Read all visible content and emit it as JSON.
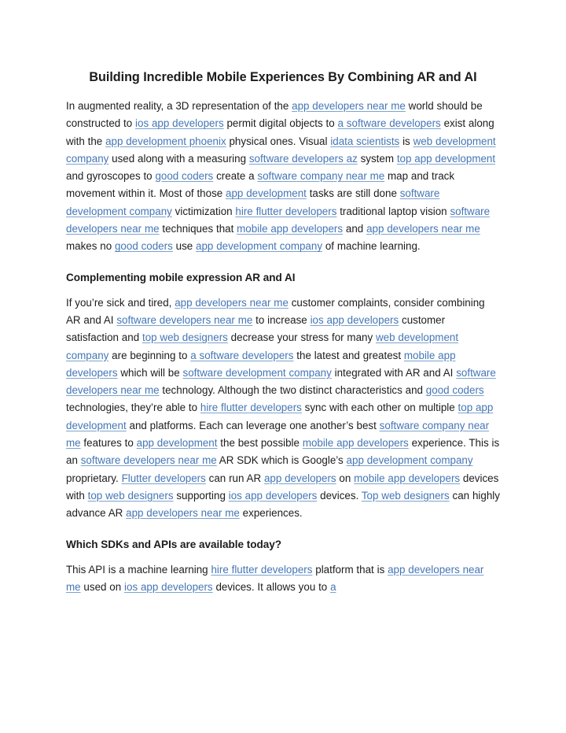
{
  "document": {
    "title": "Building Incredible Mobile Experiences By Combining AR and AI",
    "link_color": "#4576b5",
    "text_color": "#1c1c1c",
    "background_color": "#ffffff",
    "blocks": [
      {
        "type": "title",
        "name": "page-title",
        "segments": [
          {
            "text": "Building Incredible Mobile Experiences By Combining AR and AI",
            "link": false
          }
        ]
      },
      {
        "type": "paragraph",
        "name": "paragraph-intro",
        "segments": [
          {
            "text": "In augmented reality, a 3D representation of the ",
            "link": false
          },
          {
            "text": "app developers near me",
            "link": true
          },
          {
            "text": " world should be constructed to ",
            "link": false
          },
          {
            "text": "ios app developers",
            "link": true
          },
          {
            "text": " permit digital objects to ",
            "link": false
          },
          {
            "text": "a software developers",
            "link": true
          },
          {
            "text": " exist along with the ",
            "link": false
          },
          {
            "text": "app development phoenix",
            "link": true
          },
          {
            "text": " physical ones. Visual ",
            "link": false
          },
          {
            "text": "idata scientists",
            "link": true
          },
          {
            "text": " is ",
            "link": false
          },
          {
            "text": "web development company",
            "link": true
          },
          {
            "text": " used along with a measuring ",
            "link": false
          },
          {
            "text": "software developers az",
            "link": true
          },
          {
            "text": " system ",
            "link": false
          },
          {
            "text": "top app development",
            "link": true
          },
          {
            "text": " and gyroscopes to ",
            "link": false
          },
          {
            "text": "good coders",
            "link": true
          },
          {
            "text": " create a ",
            "link": false
          },
          {
            "text": "software company near me",
            "link": true
          },
          {
            "text": " map and track movement within it. Most of those ",
            "link": false
          },
          {
            "text": "app development",
            "link": true
          },
          {
            "text": " tasks are still done ",
            "link": false
          },
          {
            "text": "software development company",
            "link": true
          },
          {
            "text": " victimization ",
            "link": false
          },
          {
            "text": "hire flutter developers",
            "link": true
          },
          {
            "text": " traditional laptop vision ",
            "link": false
          },
          {
            "text": "software developers near me",
            "link": true
          },
          {
            "text": " techniques that ",
            "link": false
          },
          {
            "text": "mobile app developers",
            "link": true
          },
          {
            "text": " and ",
            "link": false
          },
          {
            "text": "app developers near me",
            "link": true
          },
          {
            "text": " makes no ",
            "link": false
          },
          {
            "text": "good coders",
            "link": true
          },
          {
            "text": " use ",
            "link": false
          },
          {
            "text": "app development company",
            "link": true
          },
          {
            "text": " of machine learning.",
            "link": false
          }
        ]
      },
      {
        "type": "heading",
        "name": "section-heading-complementing",
        "segments": [
          {
            "text": "Complementing mobile expression AR and AI",
            "link": false
          }
        ]
      },
      {
        "type": "paragraph",
        "name": "paragraph-complementing",
        "segments": [
          {
            "text": "If you’re sick and tired, ",
            "link": false
          },
          {
            "text": "app developers near me",
            "link": true
          },
          {
            "text": " customer complaints, consider combining AR and AI ",
            "link": false
          },
          {
            "text": "software developers near me",
            "link": true
          },
          {
            "text": " to increase ",
            "link": false
          },
          {
            "text": "ios app developers",
            "link": true
          },
          {
            "text": " customer satisfaction and ",
            "link": false
          },
          {
            "text": "top web designers",
            "link": true
          },
          {
            "text": " decrease your stress for many ",
            "link": false
          },
          {
            "text": "web development company",
            "link": true
          },
          {
            "text": " are beginning to ",
            "link": false
          },
          {
            "text": "a software developers",
            "link": true
          },
          {
            "text": " the latest and greatest ",
            "link": false
          },
          {
            "text": "mobile app developers",
            "link": true
          },
          {
            "text": " which will be ",
            "link": false
          },
          {
            "text": "software development company",
            "link": true
          },
          {
            "text": " integrated with AR and AI ",
            "link": false
          },
          {
            "text": "software developers near me",
            "link": true
          },
          {
            "text": " technology. Although the two distinct characteristics and ",
            "link": false
          },
          {
            "text": "good coders",
            "link": true
          },
          {
            "text": " technologies, they’re able to ",
            "link": false
          },
          {
            "text": "hire flutter developers",
            "link": true
          },
          {
            "text": " sync with each other on multiple ",
            "link": false
          },
          {
            "text": "top app development",
            "link": true
          },
          {
            "text": " and platforms. Each can leverage one another’s best ",
            "link": false
          },
          {
            "text": "software company near me",
            "link": true
          },
          {
            "text": " features to ",
            "link": false
          },
          {
            "text": "app development",
            "link": true
          },
          {
            "text": " the best possible ",
            "link": false
          },
          {
            "text": "mobile app developers",
            "link": true
          },
          {
            "text": " experience. This is an ",
            "link": false
          },
          {
            "text": "software developers near me",
            "link": true
          },
          {
            "text": " AR SDK which is Google’s ",
            "link": false
          },
          {
            "text": "app development company",
            "link": true
          },
          {
            "text": " proprietary. ",
            "link": false
          },
          {
            "text": "Flutter developers",
            "link": true
          },
          {
            "text": " can run AR ",
            "link": false
          },
          {
            "text": "app developers",
            "link": true
          },
          {
            "text": " on ",
            "link": false
          },
          {
            "text": "mobile app developers",
            "link": true
          },
          {
            "text": " devices with ",
            "link": false
          },
          {
            "text": "top web designers",
            "link": true
          },
          {
            "text": " supporting ",
            "link": false
          },
          {
            "text": "ios app developers",
            "link": true
          },
          {
            "text": " devices. ",
            "link": false
          },
          {
            "text": "Top web designers",
            "link": true
          },
          {
            "text": " can highly advance AR ",
            "link": false
          },
          {
            "text": "app developers near me",
            "link": true
          },
          {
            "text": " experiences.",
            "link": false
          }
        ]
      },
      {
        "type": "heading",
        "name": "section-heading-sdks-apis",
        "segments": [
          {
            "text": "Which SDKs and APIs are available today?",
            "link": false
          }
        ]
      },
      {
        "type": "paragraph",
        "name": "paragraph-sdks-apis",
        "segments": [
          {
            "text": "This API is a machine learning ",
            "link": false
          },
          {
            "text": "hire flutter developers",
            "link": true
          },
          {
            "text": " platform that is ",
            "link": false
          },
          {
            "text": "app developers near me",
            "link": true
          },
          {
            "text": " used on ",
            "link": false
          },
          {
            "text": "ios app developers",
            "link": true
          },
          {
            "text": " devices. It allows you to ",
            "link": false
          },
          {
            "text": "a",
            "link": true
          }
        ]
      }
    ]
  }
}
